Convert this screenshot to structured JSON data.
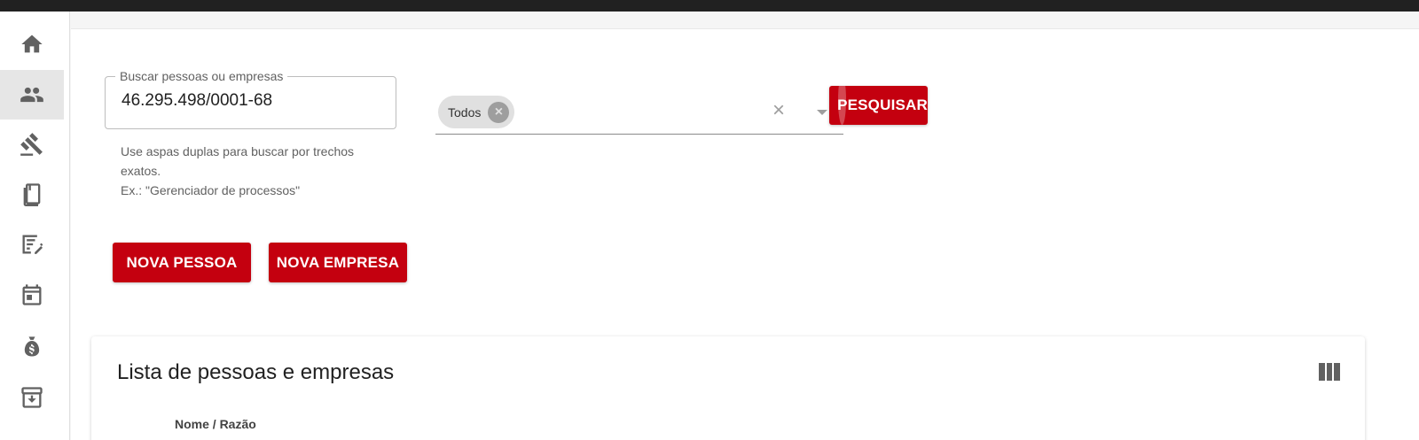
{
  "sidebar": {
    "items": [
      {
        "name": "home",
        "icon": "home-icon",
        "active": false
      },
      {
        "name": "pessoas",
        "icon": "people-icon",
        "active": true
      },
      {
        "name": "processos",
        "icon": "gavel-icon",
        "active": false
      },
      {
        "name": "documentos",
        "icon": "book-icon",
        "active": false
      },
      {
        "name": "tarefas",
        "icon": "edit-note-icon",
        "active": false
      },
      {
        "name": "agenda",
        "icon": "calendar-icon",
        "active": false
      },
      {
        "name": "financeiro",
        "icon": "money-bag-icon",
        "active": false
      },
      {
        "name": "arquivo",
        "icon": "archive-icon",
        "active": false
      }
    ]
  },
  "search": {
    "label": "Buscar pessoas ou empresas",
    "value": "46.295.498/0001-68",
    "helper_line1": "Use aspas duplas para buscar por trechos exatos.",
    "helper_line2": "Ex.: \"Gerenciador de processos\""
  },
  "filter": {
    "chip_label": "Todos",
    "chip_delete_icon": "cancel-icon",
    "clear_icon": "close-icon",
    "dropdown_icon": "arrow-drop-down-icon"
  },
  "buttons": {
    "search_label": "PESQUISAR",
    "new_person_label": "NOVA PESSOA",
    "new_company_label": "NOVA EMPRESA"
  },
  "list": {
    "title": "Lista de pessoas e empresas",
    "columns_icon": "view-column-icon",
    "first_column_header": "Nome / Razão"
  },
  "colors": {
    "primary": "#c4000f",
    "topbar": "#212121",
    "sidebar_active": "#e6e6e6"
  }
}
